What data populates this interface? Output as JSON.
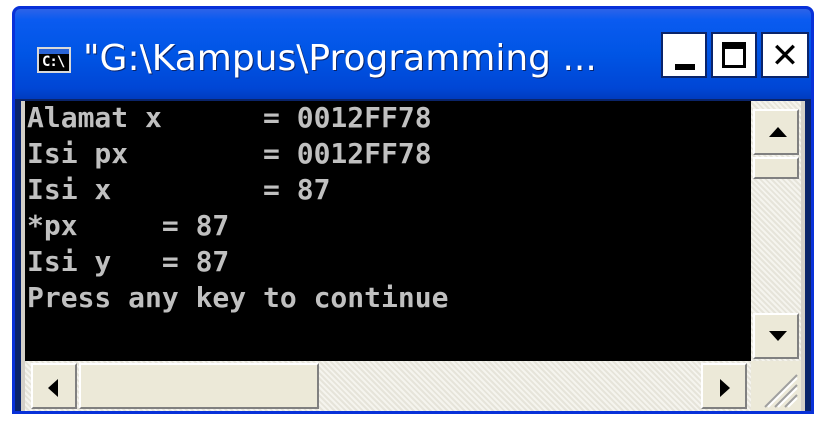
{
  "window": {
    "title": "\"G:\\Kampus\\Programming ...",
    "icon_name": "console-icon",
    "icon_label": "C:\\"
  },
  "console": {
    "lines": [
      "Alamat x      = 0012FF78",
      "Isi px        = 0012FF78",
      "Isi x         = 87",
      "*px     = 87",
      "Isi y   = 87",
      "Press any key to continue"
    ],
    "foreground_color": "#c0c0c0",
    "background_color": "#000000"
  },
  "colors": {
    "titlebar": "#0055e5",
    "frame": "#0831d9"
  }
}
